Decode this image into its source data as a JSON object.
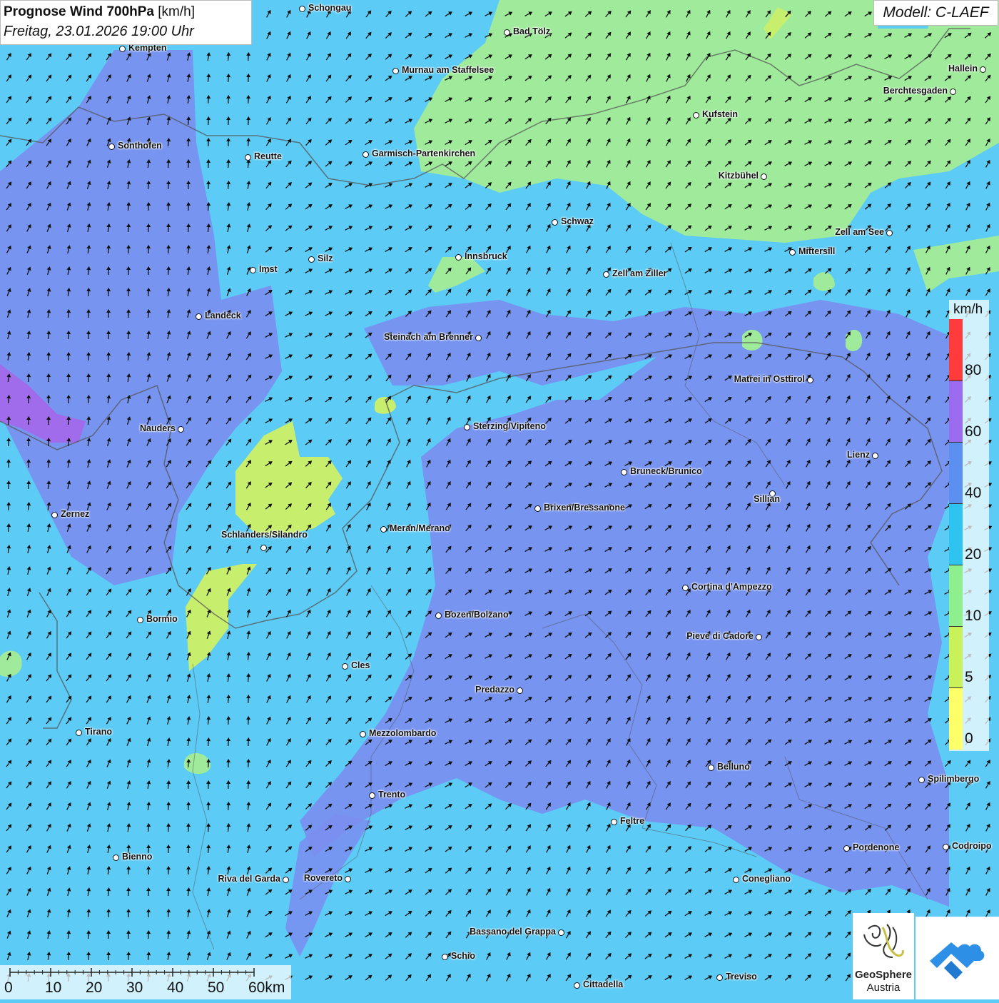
{
  "title": {
    "bold": "Prognose Wind 700hPa",
    "unit": "[km/h]",
    "datetime": "Freitag, 23.01.2026 19:00 Uhr"
  },
  "model": "Modell: C-LAEF",
  "colors": {
    "base": "#5ccbf5",
    "strong": "#7a8ef0",
    "stronger": "#9a73ea",
    "calm_green": "#9feb9b",
    "calm_yellowgreen": "#c8ee6e"
  },
  "legend": {
    "unit": "km/h",
    "bands": [
      {
        "color": "#ff3b3b"
      },
      {
        "color": "#9b6cf0"
      },
      {
        "color": "#5b8ff0"
      },
      {
        "color": "#2fc3ef"
      },
      {
        "color": "#8ef08c"
      },
      {
        "color": "#c9f25a"
      },
      {
        "color": "#ffff6a"
      }
    ],
    "ticks": [
      "80",
      "60",
      "40",
      "20",
      "10",
      "5",
      "0"
    ]
  },
  "scale": {
    "labels": [
      "0",
      "10",
      "20",
      "30",
      "40",
      "50",
      "60km"
    ]
  },
  "logos": {
    "geosphere_line1": "GeoSphere",
    "geosphere_line2": "Austria"
  },
  "arrow_icon": "wind-arrow-icon",
  "cities": [
    {
      "name": "Schongau",
      "side": "r"
    },
    {
      "name": "Bad Tölz",
      "side": "r"
    },
    {
      "name": "Kempten",
      "side": "r"
    },
    {
      "name": "Hallein",
      "side": "l"
    },
    {
      "name": "Murnau am Staffelsee",
      "side": "r"
    },
    {
      "name": "Berchtesgaden",
      "side": "l"
    },
    {
      "name": "Kufstein",
      "side": "r"
    },
    {
      "name": "Sonthofen",
      "side": "r"
    },
    {
      "name": "Reutte",
      "side": "r"
    },
    {
      "name": "Garmisch-Partenkirchen",
      "side": "r"
    },
    {
      "name": "Kitzbühel",
      "side": "l"
    },
    {
      "name": "Schwaz",
      "side": "r"
    },
    {
      "name": "Zell am See",
      "side": "l"
    },
    {
      "name": "Mittersill",
      "side": "r"
    },
    {
      "name": "Innsbruck",
      "side": "r"
    },
    {
      "name": "Silz",
      "side": "r"
    },
    {
      "name": "Imst",
      "side": "r"
    },
    {
      "name": "Zell am Ziller",
      "side": "r"
    },
    {
      "name": "Landeck",
      "side": "r"
    },
    {
      "name": "Steinach am Brenner",
      "side": "l"
    },
    {
      "name": "Matrei in Osttirol",
      "side": "l"
    },
    {
      "name": "Nauders",
      "side": "l"
    },
    {
      "name": "Sterzing/Vipiteno",
      "side": "r"
    },
    {
      "name": "Lienz",
      "side": "l"
    },
    {
      "name": "Bruneck/Brunico",
      "side": "r"
    },
    {
      "name": "Sillian",
      "side": "b"
    },
    {
      "name": "Zernez",
      "side": "r"
    },
    {
      "name": "Brixen/Bressanone",
      "side": "r"
    },
    {
      "name": "Meran/Merano",
      "side": "r"
    },
    {
      "name": "Schlanders/Silandro",
      "side": "a"
    },
    {
      "name": "Cortina d'Ampezzo",
      "side": "r"
    },
    {
      "name": "Bozen/Bolzano",
      "side": "r"
    },
    {
      "name": "Bormio",
      "side": "r"
    },
    {
      "name": "Pieve di Cadore",
      "side": "l"
    },
    {
      "name": "Cles",
      "side": "r"
    },
    {
      "name": "Predazzo",
      "side": "l"
    },
    {
      "name": "Tirano",
      "side": "r"
    },
    {
      "name": "Mezzolombardo",
      "side": "r"
    },
    {
      "name": "Belluno",
      "side": "r"
    },
    {
      "name": "Spilimbergo",
      "side": "r"
    },
    {
      "name": "Trento",
      "side": "r"
    },
    {
      "name": "Feltre",
      "side": "r"
    },
    {
      "name": "Pordenone",
      "side": "r"
    },
    {
      "name": "Codroipo",
      "side": "r"
    },
    {
      "name": "Bienno",
      "side": "r"
    },
    {
      "name": "Riva del Garda",
      "side": "l"
    },
    {
      "name": "Rovereto",
      "side": "l"
    },
    {
      "name": "Conegliano",
      "side": "r"
    },
    {
      "name": "Bassano del Grappa",
      "side": "l"
    },
    {
      "name": "Schio",
      "side": "r"
    },
    {
      "name": "Treviso",
      "side": "r"
    },
    {
      "name": "Cittadella",
      "side": "r"
    }
  ]
}
